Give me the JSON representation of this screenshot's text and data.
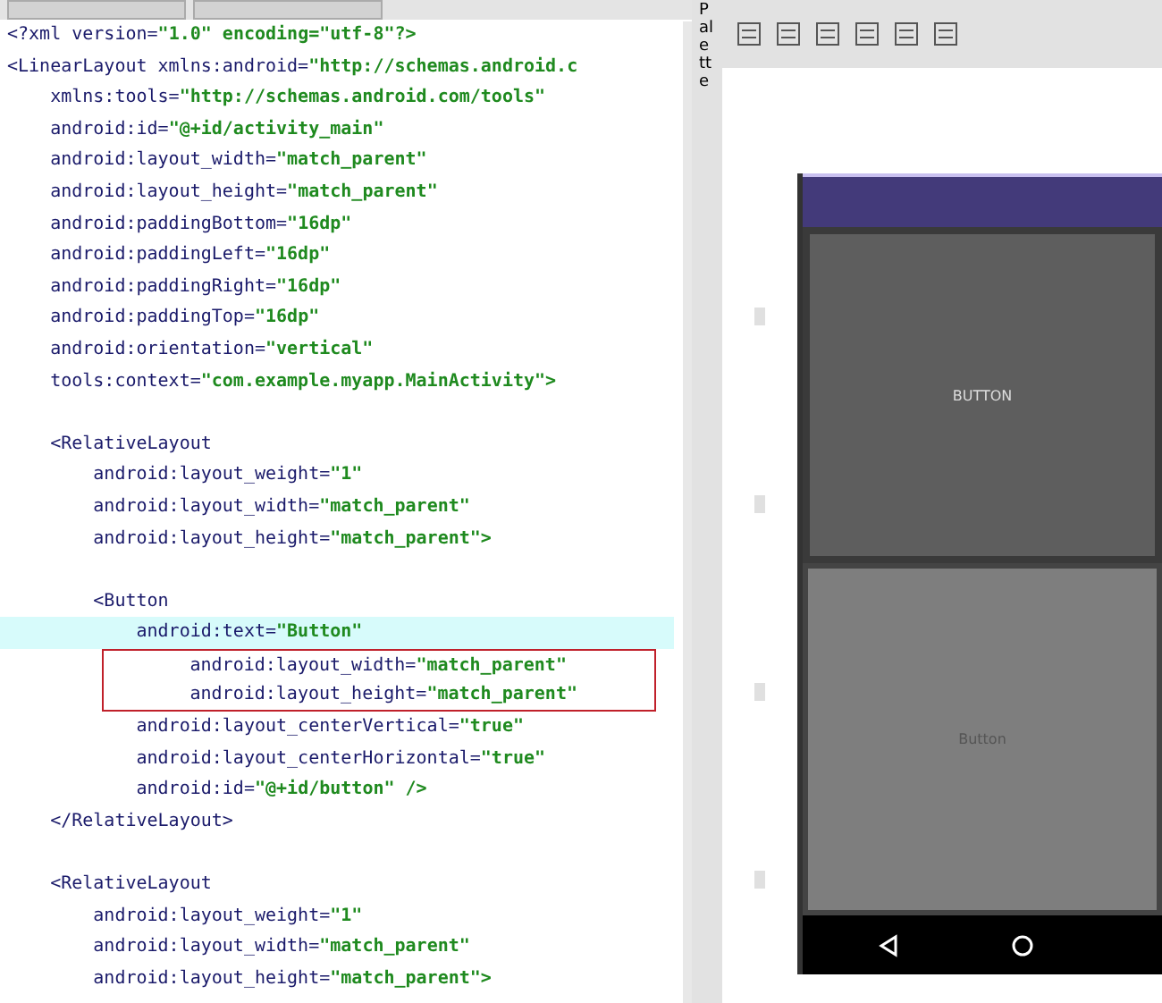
{
  "editor": {
    "lines": [
      {
        "text": "<?xml version=\"1.0\" encoding=\"utf-8\"?>",
        "highlighted": false,
        "boxed": false
      },
      {
        "text": "<LinearLayout xmlns:android=\"http://schemas.android.c",
        "highlighted": false,
        "boxed": false
      },
      {
        "text": "    xmlns:tools=\"http://schemas.android.com/tools\"",
        "highlighted": false,
        "boxed": false
      },
      {
        "text": "    android:id=\"@+id/activity_main\"",
        "highlighted": false,
        "boxed": false
      },
      {
        "text": "    android:layout_width=\"match_parent\"",
        "highlighted": false,
        "boxed": false
      },
      {
        "text": "    android:layout_height=\"match_parent\"",
        "highlighted": false,
        "boxed": false
      },
      {
        "text": "    android:paddingBottom=\"16dp\"",
        "highlighted": false,
        "boxed": false
      },
      {
        "text": "    android:paddingLeft=\"16dp\"",
        "highlighted": false,
        "boxed": false
      },
      {
        "text": "    android:paddingRight=\"16dp\"",
        "highlighted": false,
        "boxed": false
      },
      {
        "text": "    android:paddingTop=\"16dp\"",
        "highlighted": false,
        "boxed": false
      },
      {
        "text": "    android:orientation=\"vertical\"",
        "highlighted": false,
        "boxed": false
      },
      {
        "text": "    tools:context=\"com.example.myapp.MainActivity\">",
        "highlighted": false,
        "boxed": false
      },
      {
        "highlighted": false,
        "boxed": false
      },
      {
        "text": "    <RelativeLayout",
        "highlighted": false,
        "boxed": false
      },
      {
        "text": "        android:layout_weight=\"1\"",
        "highlighted": false,
        "boxed": false
      },
      {
        "text": "        android:layout_width=\"match_parent\"",
        "highlighted": false,
        "boxed": false
      },
      {
        "text": "        android:layout_height=\"match_parent\">",
        "highlighted": false,
        "boxed": false
      },
      {
        "highlighted": false,
        "boxed": false
      },
      {
        "text": "        <Button",
        "highlighted": false,
        "boxed": false
      },
      {
        "text": "            android:text=\"Button\"",
        "highlighted": true,
        "boxed": false
      },
      {
        "text": "            android:layout_width=\"match_parent\"",
        "highlighted": false,
        "boxed": true
      },
      {
        "text": "            android:layout_height=\"match_parent\"",
        "highlighted": false,
        "boxed": true
      },
      {
        "text": "            android:layout_centerVertical=\"true\"",
        "highlighted": false,
        "boxed": false
      },
      {
        "text": "            android:layout_centerHorizontal=\"true\"",
        "highlighted": false,
        "boxed": false
      },
      {
        "text": "            android:id=\"@+id/button\" />",
        "highlighted": false,
        "boxed": false
      },
      {
        "text": "    </RelativeLayout>",
        "highlighted": false,
        "boxed": false
      },
      {
        "highlighted": false,
        "boxed": false
      },
      {
        "text": "    <RelativeLayout",
        "highlighted": false,
        "boxed": false
      },
      {
        "text": "        android:layout_weight=\"1\"",
        "highlighted": false,
        "boxed": false
      },
      {
        "text": "        android:layout_width=\"match_parent\"",
        "highlighted": false,
        "boxed": false
      },
      {
        "text": "        android:layout_height=\"match_parent\">",
        "highlighted": false,
        "boxed": false
      }
    ]
  },
  "palette_tab": {
    "label": "Palette"
  },
  "preview": {
    "top_button": {
      "label": "BUTTON"
    },
    "bottom_button": {
      "label": "Button"
    }
  }
}
